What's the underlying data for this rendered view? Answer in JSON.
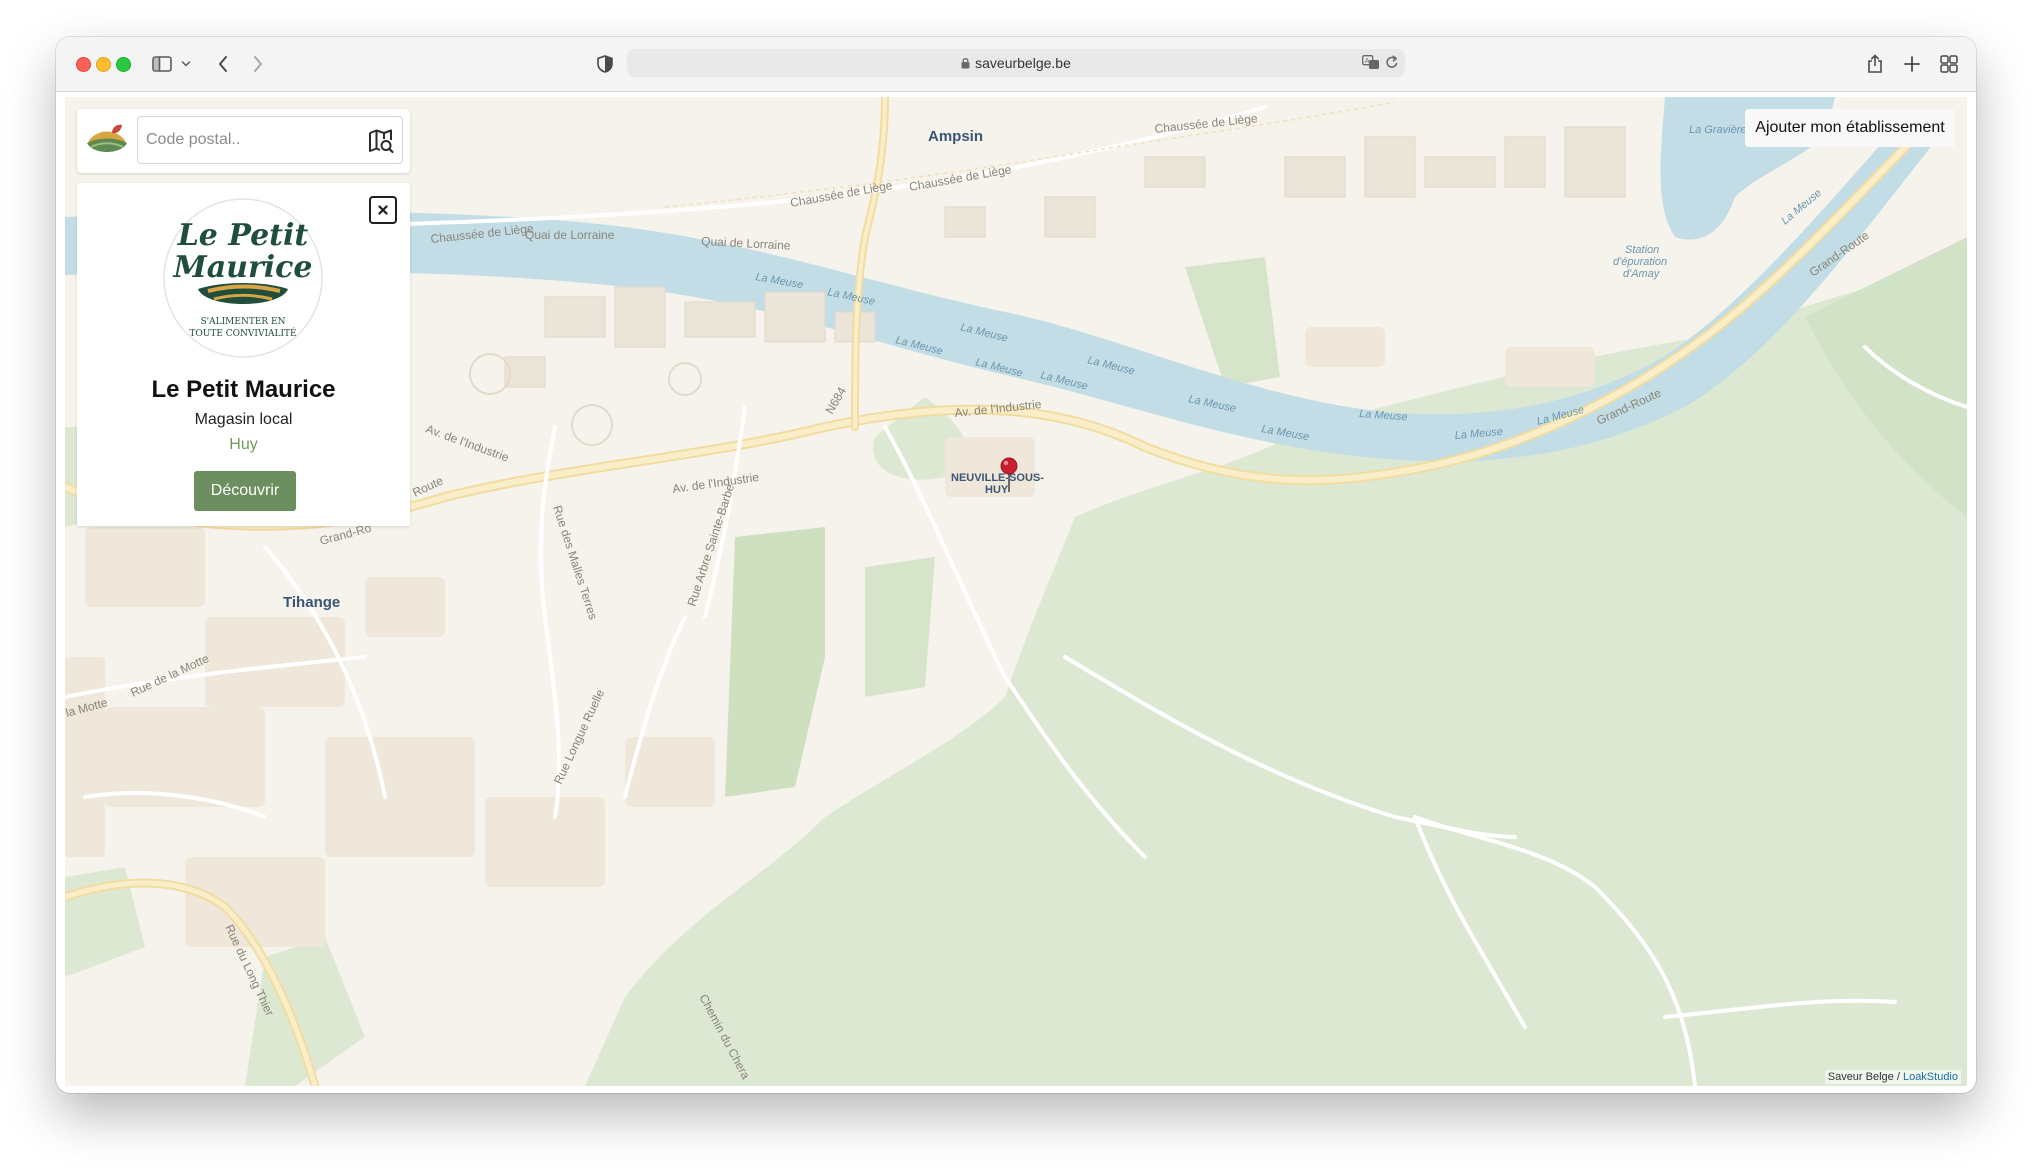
{
  "browser": {
    "url": "saveurbelge.be",
    "icons": [
      "sidebar-icon",
      "chevron-down-icon",
      "back-icon",
      "forward-icon",
      "privacy-shield-icon",
      "lock-icon",
      "translate-icon",
      "reload-icon",
      "share-icon",
      "new-tab-icon",
      "tab-overview-icon"
    ]
  },
  "search": {
    "placeholder": "Code postal.."
  },
  "store": {
    "name": "Le Petit Maurice",
    "type": "Magasin local",
    "city": "Huy",
    "button_label": "Découvrir",
    "logo": {
      "line1": "Le Petit",
      "line2": "Maurice",
      "tagline1": "S'ALIMENTER EN",
      "tagline2": "TOUTE CONVIVIALITÉ"
    }
  },
  "add_business_label": "Ajouter mon établissement",
  "attribution": {
    "brand": "Saveur Belge",
    "separator": " / ",
    "studio": "LoakStudio"
  },
  "map": {
    "towns": {
      "ampsin": "Ampsin",
      "tihange": "Tihange",
      "neuville_1": "NEUVILLE-SOUS-",
      "neuville_2": "HUY"
    },
    "roads": {
      "chaussee_liege_1": "Chaussée de Liège",
      "chaussee_liege_2": "Chaussée de Liège",
      "chaussee_liege_3": "Chaussée de Liège",
      "chaussee_liege_4": "Chaussée de Liège",
      "quai_lorraine_1": "Quai de Lorraine",
      "quai_lorraine_2": "Quai de Lorraine",
      "av_industrie_1": "Av. de l'Industrie",
      "av_industrie_2": "Av. de l'Industrie",
      "av_industrie_3": "Av. de l'Industrie",
      "n684": "N684",
      "grand_route_1": "Grand-Route",
      "grand_route_2": "Grand-Route",
      "grand_route_3": "Grand-Ro",
      "route": "Route",
      "rue_malles_terres": "Rue des Malles Terres",
      "rue_arbre_sainte_barbe": "Rue Arbre Sainte-Barbe",
      "rue_longue_ruelle": "Rue Longue Ruelle",
      "rue_de_la_motte": "Rue de la Motte",
      "la_motte": "la Motte",
      "rue_long_thier": "Rue du Long Thier",
      "chemin_chera": "Chemin du Chera"
    },
    "water": {
      "meuse": "La Meuse",
      "graviere": "La Gravière",
      "station_1": "Station",
      "station_2": "d'épuration",
      "station_3": "d'Amay"
    }
  }
}
